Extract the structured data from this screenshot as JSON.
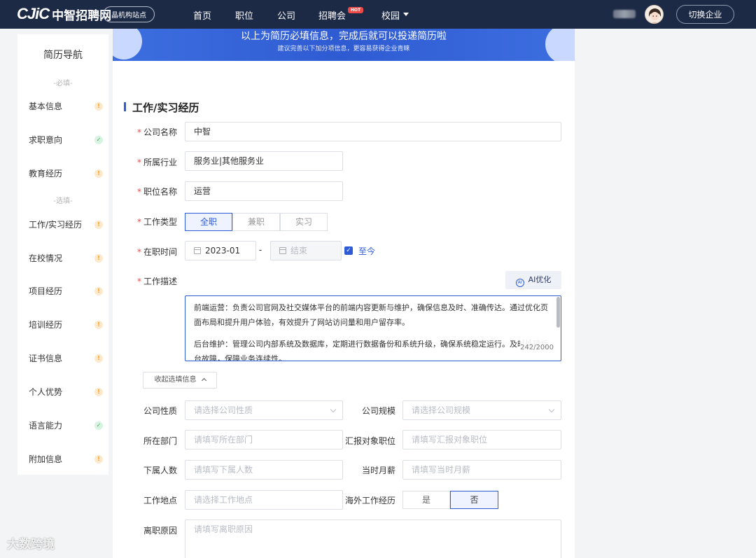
{
  "header": {
    "logo_mark": "CJiC",
    "logo_name": "中智招聘网",
    "site_label": "晶机构站点",
    "nav": [
      "首页",
      "职位",
      "公司",
      "招聘会",
      "校园"
    ],
    "hot_badge": "HOT",
    "switch_label": "切换企业"
  },
  "sidebar": {
    "title": "简历导航",
    "required_label": "-必填-",
    "optional_label": "-选填-",
    "required_items": [
      {
        "label": "基本信息",
        "status": "warn"
      },
      {
        "label": "求职意向",
        "status": "ok"
      },
      {
        "label": "教育经历",
        "status": "warn"
      }
    ],
    "optional_items": [
      {
        "label": "工作/实习经历",
        "status": "warn"
      },
      {
        "label": "在校情况",
        "status": "warn"
      },
      {
        "label": "项目经历",
        "status": "warn"
      },
      {
        "label": "培训经历",
        "status": "warn"
      },
      {
        "label": "证书信息",
        "status": "warn"
      },
      {
        "label": "个人优势",
        "status": "warn"
      },
      {
        "label": "语言能力",
        "status": "ok"
      },
      {
        "label": "附加信息",
        "status": "warn"
      }
    ]
  },
  "banner": {
    "title": "以上为简历必填信息，完成后就可以投递简历啦",
    "subtitle": "建议完善以下加分项信息，更容易获得企业青睐"
  },
  "section": {
    "title": "工作/实习经历",
    "company_label": "公司名称",
    "company_value": "中智",
    "industry_label": "所属行业",
    "industry_value": "服务业|其他服务业",
    "position_label": "职位名称",
    "position_value": "运营",
    "job_type_label": "工作类型",
    "job_types": [
      "全职",
      "兼职",
      "实习"
    ],
    "period_label": "在职时间",
    "start_value": "2023-01",
    "dash": "-",
    "end_placeholder": "结束",
    "until_now": "至今",
    "desc_label": "工作描述",
    "ai_label": "AI优化",
    "ai_icon_text": "AI",
    "desc_paragraphs": [
      "前端运营：负责公司官网及社交媒体平台的前端内容更新与维护，确保信息及时、准确传达。通过优化页面布局和提升用户体验，有效提升了网站访问量和用户留存率。",
      "后台维护：管理公司内部系统及数据库，定期进行数据备份和系统升级，确保系统稳定运行。及时处理后台故障，保障业务连续性。"
    ],
    "desc_counter": "242/2000",
    "collapse_label": "收起选填信息"
  },
  "optional": {
    "nature_label": "公司性质",
    "nature_placeholder": "请选择公司性质",
    "scale_label": "公司规模",
    "scale_placeholder": "请选择公司规模",
    "dept_label": "所在部门",
    "dept_placeholder": "请填写所在部门",
    "report_label": "汇报对象职位",
    "report_placeholder": "请填写汇报对象职位",
    "sub_label": "下属人数",
    "sub_placeholder": "请填写下属人数",
    "salary_label": "当时月薪",
    "salary_placeholder": "请填写当时月薪",
    "location_label": "工作地点",
    "location_placeholder": "请选择工作地点",
    "overseas_label": "海外工作经历",
    "overseas_yes": "是",
    "overseas_no": "否",
    "leave_label": "离职原因",
    "leave_placeholder": "请填写离职原因"
  },
  "watermark": "大数跨境",
  "colors": {
    "accent": "#2e5bd6",
    "header_bg": "#1d2a46",
    "required": "#e64b4b"
  }
}
